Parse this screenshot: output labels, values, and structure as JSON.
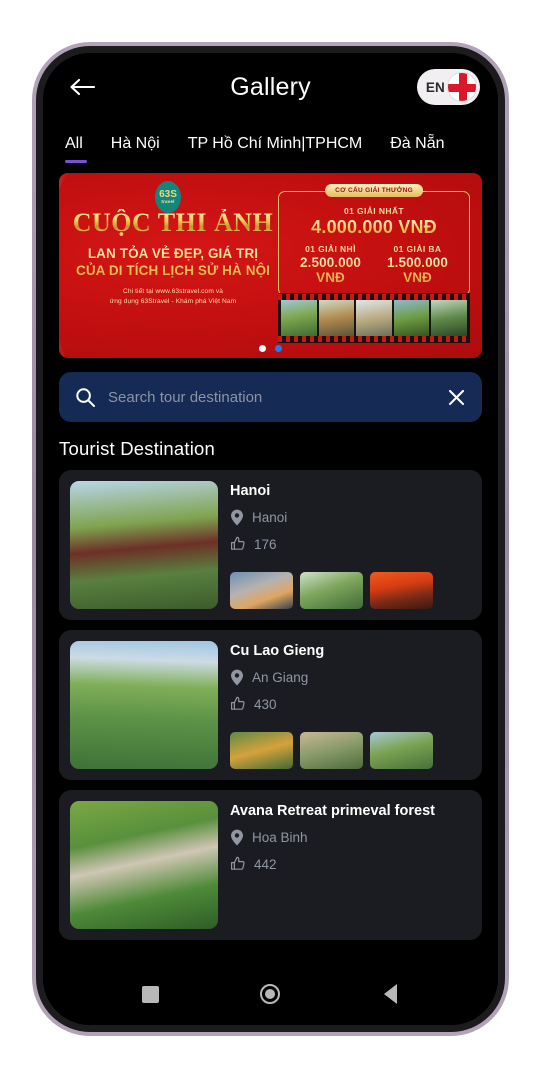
{
  "header": {
    "title": "Gallery",
    "back_icon": "arrow-left-icon",
    "language_code": "EN",
    "flag_icon": "england-flag-icon"
  },
  "tabs": [
    {
      "label": "All",
      "active": true
    },
    {
      "label": "Hà Nội",
      "active": false
    },
    {
      "label": "TP Hồ Chí Minh|TPHCM",
      "active": false
    },
    {
      "label": "Đà Nẵn",
      "active": false
    }
  ],
  "banner": {
    "logo_primary": "63S",
    "logo_secondary": "travel",
    "title": "CUỘC THI ẢNH",
    "subtitle_line1": "LAN TỎA VẺ ĐẸP, GIÁ TRỊ",
    "subtitle_line2": "CỦA DI TÍCH LỊCH SỬ HÀ NỘI",
    "note_line1": "Chi tiết tại www.63stravel.com và",
    "note_line2": "ứng dụng 63Stravel - Khám phá Việt Nam",
    "prize": {
      "tag": "CƠ CẤU GIẢI THƯỞNG",
      "first_label": "01 GIẢI NHẤT",
      "first_amount": "4.000.000 VNĐ",
      "second_label": "01 GIẢI NHÌ",
      "second_amount": "2.500.000 VNĐ",
      "third_label": "01 GIẢI BA",
      "third_amount": "1.500.000 VNĐ"
    },
    "dots": [
      {
        "state": "inactive",
        "color": "#ffffff"
      },
      {
        "state": "active",
        "color": "#1e7ef0"
      }
    ]
  },
  "search": {
    "placeholder": "Search tour destination",
    "value": "",
    "search_icon": "search-icon",
    "clear_icon": "close-icon",
    "background_color": "#152a54"
  },
  "section": {
    "title": "Tourist Destination"
  },
  "cards": [
    {
      "name": "Hanoi",
      "location": "Hanoi",
      "likes": "176",
      "location_icon": "map-pin-icon",
      "like_icon": "thumbs-up-icon"
    },
    {
      "name": "Cu Lao Gieng",
      "location": "An Giang",
      "likes": "430",
      "location_icon": "map-pin-icon",
      "like_icon": "thumbs-up-icon"
    },
    {
      "name": "Avana Retreat primeval forest",
      "location": "Hoa Binh",
      "likes": "442",
      "location_icon": "map-pin-icon",
      "like_icon": "thumbs-up-icon"
    }
  ],
  "android_nav": {
    "recents": "recents-square-icon",
    "home": "home-circle-icon",
    "back": "back-triangle-icon"
  },
  "theme": {
    "accent": "#7a4fd6",
    "screen_background": "#000000",
    "card_background": "#1a1c22",
    "frame_color": "#b3a3b8"
  }
}
